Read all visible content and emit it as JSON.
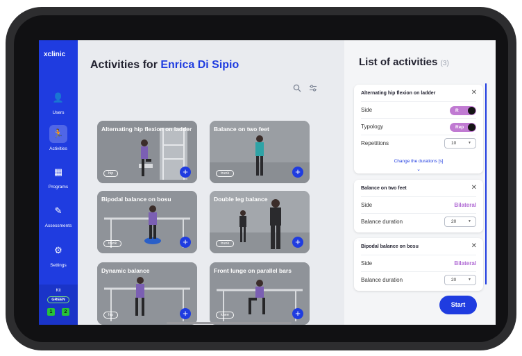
{
  "brand": "xclinic",
  "nav": [
    {
      "label": "Users",
      "icon": "user-icon",
      "glyph": "👤",
      "active": false
    },
    {
      "label": "Activities",
      "icon": "activity-icon",
      "glyph": "🏃",
      "active": true
    },
    {
      "label": "Programs",
      "icon": "programs-icon",
      "glyph": "▦",
      "active": false
    },
    {
      "label": "Assessments",
      "icon": "assessment-icon",
      "glyph": "✎",
      "active": false
    },
    {
      "label": "Settings",
      "icon": "gear-icon",
      "glyph": "⚙",
      "active": false
    }
  ],
  "kit": {
    "label": "Kit",
    "badge": "GREEN",
    "slot1": "1",
    "slot2": "2"
  },
  "header": {
    "prefix": "Activities for ",
    "patient": "Enrica Di Sipio"
  },
  "tools": {
    "search_icon": "search-icon",
    "filter_icon": "filter-icon"
  },
  "cards": [
    {
      "title": "Alternating hip flexion on ladder",
      "tag": "hip"
    },
    {
      "title": "Balance on two feet",
      "tag": "trunk"
    },
    {
      "title": "Bipodal balance on bosu",
      "tag": "trunk"
    },
    {
      "title": "Double leg balance",
      "tag": "trunk"
    },
    {
      "title": "Dynamic balance",
      "tag": "hip"
    },
    {
      "title": "Front lunge on parallel bars",
      "tag": "knee"
    }
  ],
  "panel": {
    "title": "List of activities",
    "count": "(3)",
    "a1": {
      "title": "Alternating hip flexion on ladder",
      "side_label": "Side",
      "side_value": "R",
      "typology_label": "Typology",
      "typology_value": "Rep",
      "reps_label": "Repetitions",
      "reps_value": "10",
      "change_link": "Change the durations [s]"
    },
    "a2": {
      "title": "Balance on two feet",
      "side_label": "Side",
      "side_value": "Bilateral",
      "duration_label": "Balance duration",
      "duration_value": "20"
    },
    "a3": {
      "title": "Bipodal balance on bosu",
      "side_label": "Side",
      "side_value": "Bilateral",
      "duration_label": "Balance duration",
      "duration_value": "20"
    },
    "start_label": "Start"
  },
  "colors": {
    "accent": "#1f3ce0",
    "toggle": "#c07ad2",
    "bilateral": "#b06ad4"
  }
}
